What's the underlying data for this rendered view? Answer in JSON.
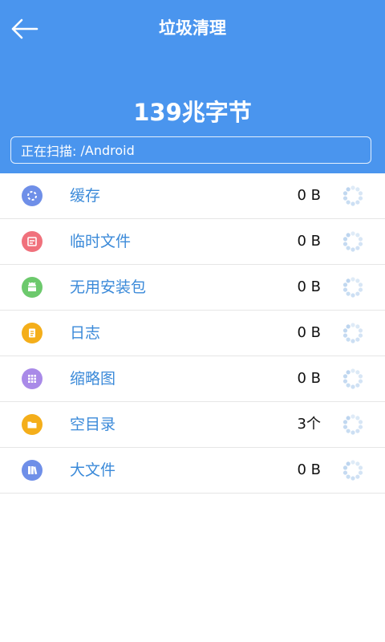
{
  "header": {
    "title": "垃圾清理",
    "total_size": "139兆字节",
    "scan_label": "正在扫描:",
    "scan_path": "/Android",
    "background_color": "#4a95ee"
  },
  "back_icon": "arrow-left-icon",
  "items": [
    {
      "label": "缓存",
      "size": "0 B",
      "icon": "cache-icon",
      "color": "#6f8fe8"
    },
    {
      "label": "临时文件",
      "size": "0 B",
      "icon": "temp-file-icon",
      "color": "#f0717c"
    },
    {
      "label": "无用安装包",
      "size": "0 B",
      "icon": "apk-icon",
      "color": "#6cc96c"
    },
    {
      "label": "日志",
      "size": "0 B",
      "icon": "log-icon",
      "color": "#f4ae1a"
    },
    {
      "label": "缩略图",
      "size": "0 B",
      "icon": "thumbnail-icon",
      "color": "#a98ae8"
    },
    {
      "label": "空目录",
      "size": "3个",
      "icon": "folder-icon",
      "color": "#f4ae1a"
    },
    {
      "label": "大文件",
      "size": "0 B",
      "icon": "large-file-icon",
      "color": "#6f8fe8"
    }
  ]
}
